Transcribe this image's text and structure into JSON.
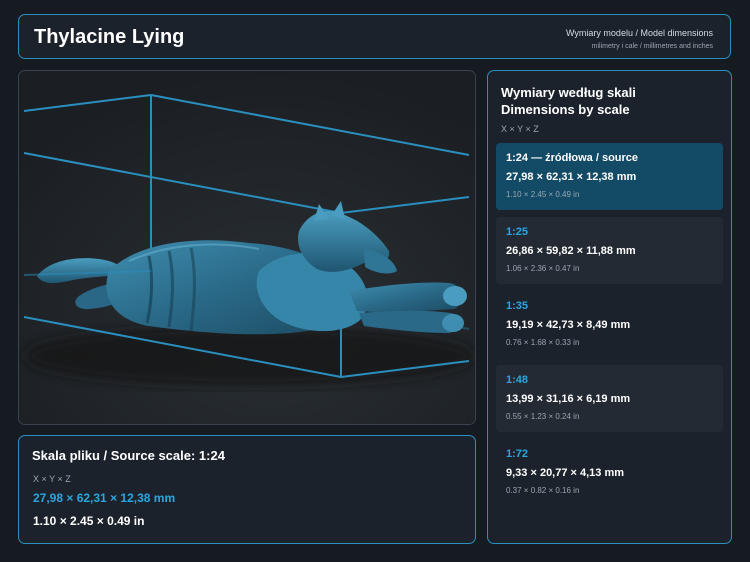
{
  "header": {
    "title": "Thylacine Lying",
    "subtitle": "Wymiary modelu / Model dimensions",
    "units": "milimetry i cale / millimetres and inches"
  },
  "source": {
    "title": "Skala pliku / Source scale: 1:24",
    "axes": "X × Y × Z",
    "mm": "27,98 × 62,31 × 12,38 mm",
    "inches": "1.10 × 2.45 × 0.49 in"
  },
  "scales_panel": {
    "title_line1": "Wymiary według skali",
    "title_line2": "Dimensions by scale",
    "axes": "X × Y × Z",
    "items": [
      {
        "label": "1:24  —  źródłowa / source",
        "mm": "27,98 × 62,31 × 12,38 mm",
        "inches": "1.10 × 2.45 × 0.49 in"
      },
      {
        "label": "1:25",
        "mm": "26,86 × 59,82 × 11,88 mm",
        "inches": "1.06 × 2.36 × 0.47 in"
      },
      {
        "label": "1:35",
        "mm": "19,19 × 42,73 × 8,49 mm",
        "inches": "0.76 × 1.68 × 0.33 in"
      },
      {
        "label": "1:48",
        "mm": "13,99 × 31,16 × 6,19 mm",
        "inches": "0.55 × 1.23 × 0.24 in"
      },
      {
        "label": "1:72",
        "mm": "9,33 × 20,77 × 4,13 mm",
        "inches": "0.37 × 0.82 × 0.16 in"
      }
    ]
  },
  "colors": {
    "accent": "#2aa7e0",
    "border": "#2a8fbf",
    "active_row": "#134a66",
    "model": "#2e6f8c",
    "background": "#161b22"
  }
}
